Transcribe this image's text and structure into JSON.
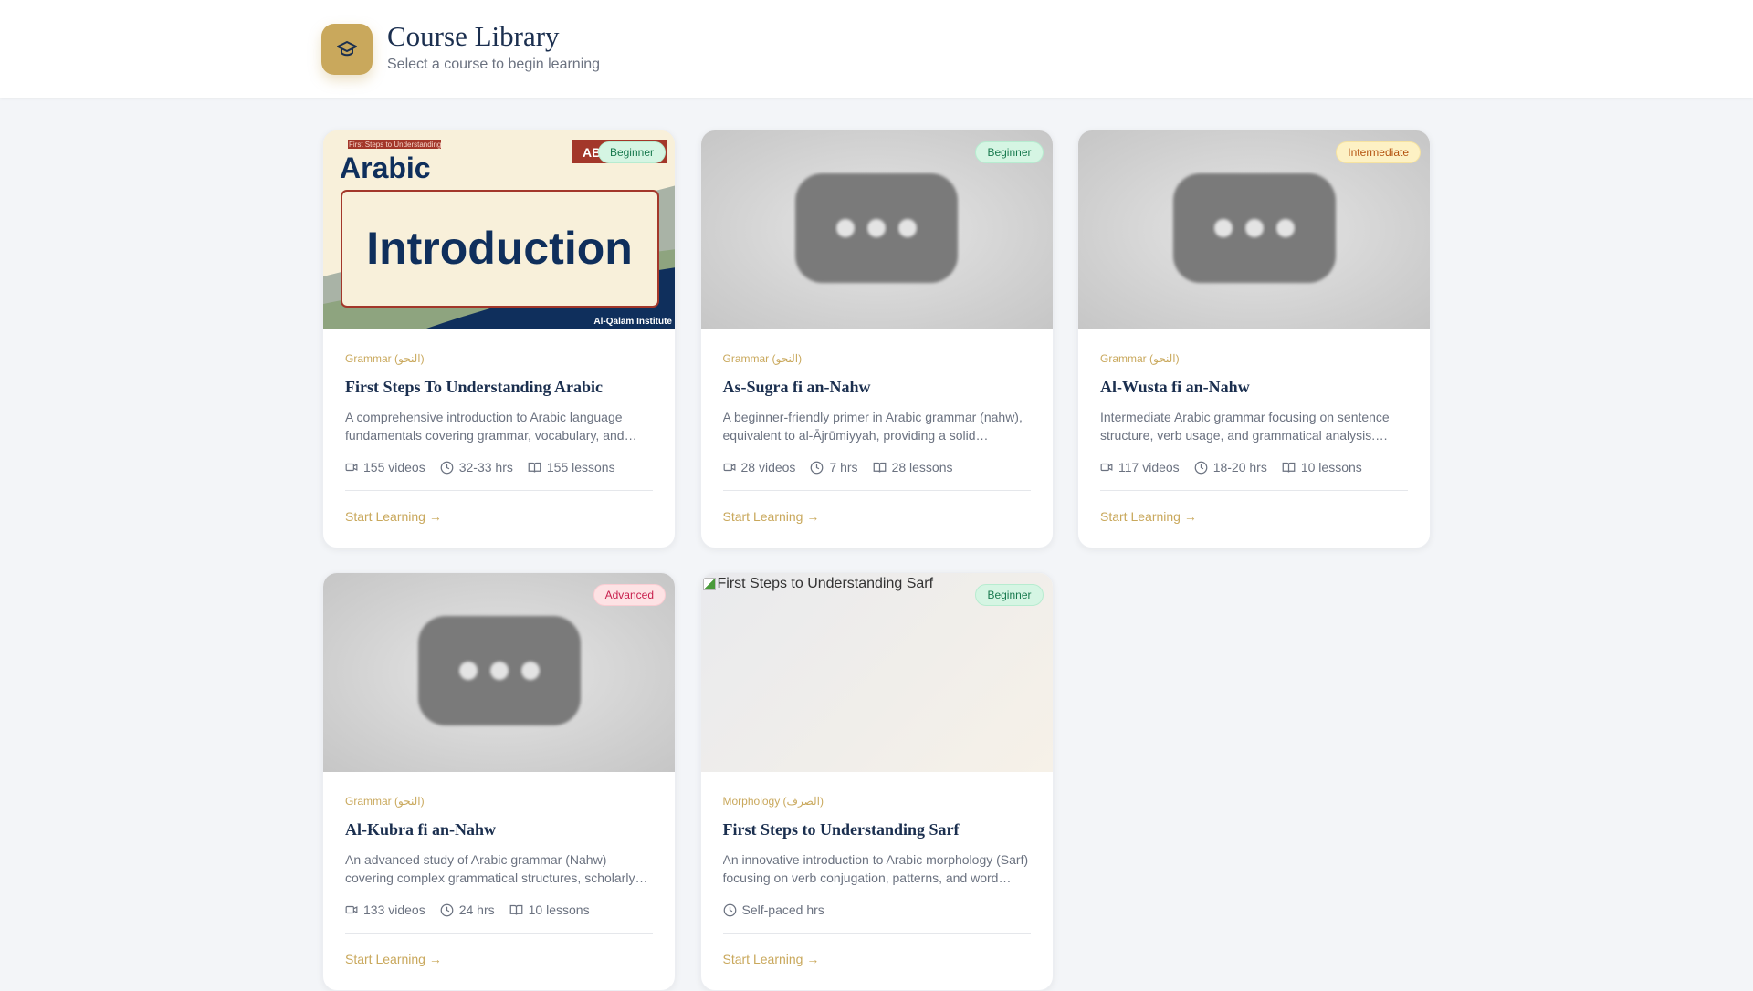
{
  "header": {
    "title": "Course Library",
    "subtitle": "Select a course to begin learning",
    "icon": "graduation-cap-icon"
  },
  "colors": {
    "accent": "#c9a85c",
    "title": "#1b2f4f"
  },
  "thumbnail_art": {
    "top_caption": "First Steps to Understanding",
    "word": "Arabic",
    "tag": "AB",
    "headline": "Introduction",
    "brand": "Al-Qalam Institute"
  },
  "courses": [
    {
      "category": "Grammar (النحو)",
      "title": "First Steps To Understanding Arabic",
      "description": "A comprehensive introduction to Arabic language fundamentals covering grammar, vocabulary, and…",
      "level": "Beginner",
      "videos": "155 videos",
      "duration": "32-33 hrs",
      "lessons": "155 lessons",
      "cta": "Start Learning →"
    },
    {
      "category": "Grammar (النحو)",
      "title": "As-Sugra fi an-Nahw",
      "description": "A beginner-friendly primer in Arabic grammar (nahw), equivalent to al-Ājrūmiyyah, providing a solid…",
      "level": "Beginner",
      "videos": "28 videos",
      "duration": "7 hrs",
      "lessons": "28 lessons",
      "cta": "Start Learning →"
    },
    {
      "category": "Grammar (النحو)",
      "title": "Al-Wusta fi an-Nahw",
      "description": "Intermediate Arabic grammar focusing on sentence structure, verb usage, and grammatical analysis.…",
      "level": "Intermediate",
      "videos": "117 videos",
      "duration": "18-20 hrs",
      "lessons": "10 lessons",
      "cta": "Start Learning →"
    },
    {
      "category": "Grammar (النحو)",
      "title": "Al-Kubra fi an-Nahw",
      "description": "An advanced study of Arabic grammar (Nahw) covering complex grammatical structures, scholarly…",
      "level": "Advanced",
      "videos": "133 videos",
      "duration": "24 hrs",
      "lessons": "10 lessons",
      "cta": "Start Learning →"
    },
    {
      "category": "Morphology (الصرف)",
      "title": "First Steps to Understanding Sarf",
      "description": "An innovative introduction to Arabic morphology (Sarf) focusing on verb conjugation, patterns, and word…",
      "level": "Beginner",
      "image_alt": "First Steps to Understanding Sarf",
      "duration": "Self-paced hrs",
      "cta": "Start Learning →"
    }
  ]
}
